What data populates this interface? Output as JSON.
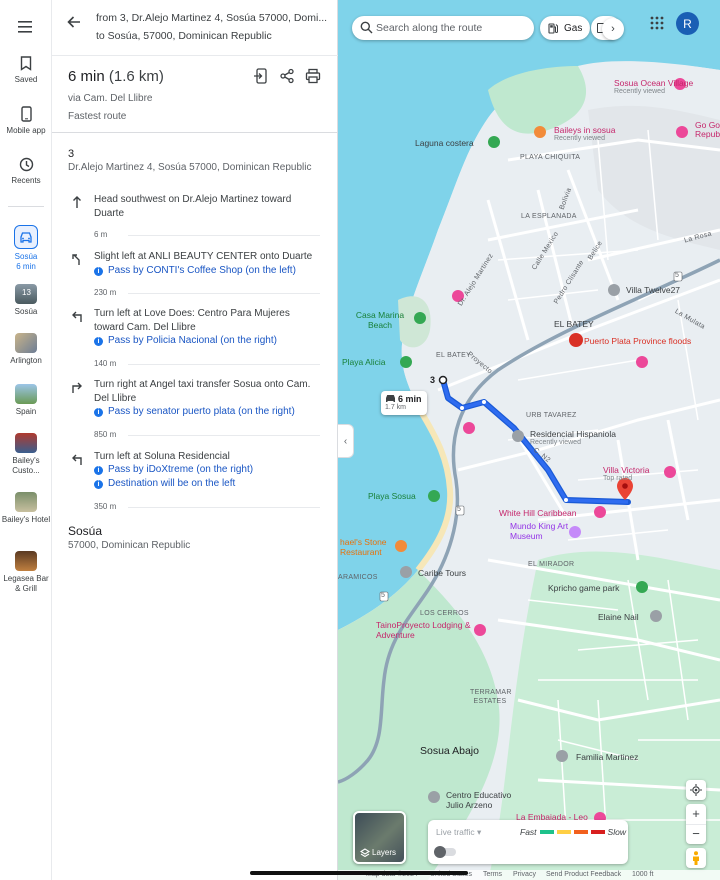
{
  "rail": {
    "saved": "Saved",
    "mobile_app": "Mobile app",
    "recents": "Recents",
    "active_dest": "Sosúa",
    "active_time": "6 min",
    "places": [
      {
        "label": "Sosúa",
        "badge": "13"
      },
      {
        "label": "Arlington"
      },
      {
        "label": "Spain"
      },
      {
        "label": "Bailey's Custo..."
      },
      {
        "label": "Bailey's Hotel"
      },
      {
        "label": "Legasea Bar & Grill"
      }
    ]
  },
  "directions": {
    "from": "from 3, Dr.Alejo Martinez 4, Sosúa 57000, Domi...",
    "to": "to Sosúa, 57000, Dominican Republic",
    "time": "6 min",
    "distance": "(1.6 km)",
    "via": "via Cam. Del Llibre",
    "route_note": "Fastest route",
    "origin_number": "3",
    "origin_address": "Dr.Alejo Martinez 4, Sosúa 57000, Dominican Republic",
    "steps": [
      {
        "icon": "straight",
        "text": "Head southwest on Dr.Alejo Martinez toward Duarte",
        "notes": [],
        "dist": "6 m"
      },
      {
        "icon": "slight-left",
        "text": "Slight left at ANLI BEAUTY CENTER onto Duarte",
        "notes": [
          "Pass by CONTI's Coffee Shop (on the left)"
        ],
        "dist": "230 m"
      },
      {
        "icon": "turn-left",
        "text": "Turn left at Love Does: Centro Para Mujeres toward Cam. Del Llibre",
        "notes": [
          "Pass by Policia Nacional (on the right)"
        ],
        "dist": "140 m"
      },
      {
        "icon": "turn-right",
        "text": "Turn right at Angel taxi transfer Sosua onto Cam. Del Llibre",
        "notes": [
          "Pass by senator puerto plata (on the right)"
        ],
        "dist": "850 m"
      },
      {
        "icon": "turn-left",
        "text": "Turn left at Soluna Residencial",
        "notes": [
          "Pass by iDoXtreme (on the right)",
          "Destination will be on the left"
        ],
        "dist": "350 m"
      }
    ],
    "dest_title": "Sosúa",
    "dest_sub": "57000, Dominican Republic"
  },
  "map": {
    "search_placeholder": "Search along the route",
    "chips": [
      "Gas"
    ],
    "avatar_letter": "R",
    "route_time": "6 min",
    "route_dist": "1.7 km",
    "origin_marker": "3",
    "labels": {
      "sosua_ocean_village": "Sosua Ocean Village",
      "recently_viewed": "Recently viewed",
      "baileys_in_sosua": "Baileys in sosua",
      "go_go": "Go Go Repub",
      "laguna_costera": "Laguna costera",
      "playa_chiquita": "PLAYA CHIQUITA",
      "la_esplanada": "LA ESPLANADA",
      "villa_twelve27": "Villa Twelve27",
      "la_mulata": "La Mulata",
      "casa_marina_beach": "Casa Marina Beach",
      "el_batey_upper": "EL BATEY",
      "el_batey_small": "EL BATEY",
      "puerto_plata_floods": "Puerto Plata Province floods",
      "playa_alicia": "Playa Alicia",
      "urb_tavarez": "URB TAVAREZ",
      "residencial_hispaniola": "Residencial Hispaniola",
      "villa_victoria": "Villa Victoria",
      "villa_victoria_sub": "Top rated",
      "playa_sosua": "Playa Sosua",
      "white_hill": "White Hill Caribbean",
      "mundo_king": "Mundo King Art Museum",
      "stone_restaurant": "hael's Stone Restaurant",
      "el_mirador": "EL MIRADOR",
      "caribe_tours": "Caribe Tours",
      "caramicos": "ARAMICOS",
      "kpricho": "Kpricho game park",
      "elaine_nail": "Elaine Nail",
      "los_cerros": "LOS CERROS",
      "taino_proyecto": "TainoProyecto Lodging & Adventure",
      "terramar": "TERRAMAR ESTATES",
      "sosua_abajo": "Sosua Abajo",
      "familia_martinez": "Familia Martinez",
      "centro_educativo": "Centro Educativo Julio Arzeno",
      "la_embajada": "La Embajada - Leo",
      "dr_alejo": "Dr. Alejo Martinez",
      "proyecto": "Proyecto",
      "pedro_clisante": "Pedro Clisante",
      "calle_mexico": "Calle Mexico",
      "belice": "Belice",
      "bolivia": "Bolivia",
      "la_rosa": "La Rosa",
      "c_n2": "C. N2",
      "road_5": "5"
    },
    "layers": "Layers",
    "live_traffic": "Live traffic",
    "fast": "Fast",
    "slow": "Slow",
    "traffic_colors": [
      "#1ec28b",
      "#ffcf44",
      "#f2601d",
      "#d81e1e"
    ],
    "footer": {
      "map_data": "Map data ©2024",
      "united_states": "United States",
      "terms": "Terms",
      "privacy": "Privacy",
      "feedback": "Send Product Feedback",
      "scale": "1000 ft"
    }
  }
}
